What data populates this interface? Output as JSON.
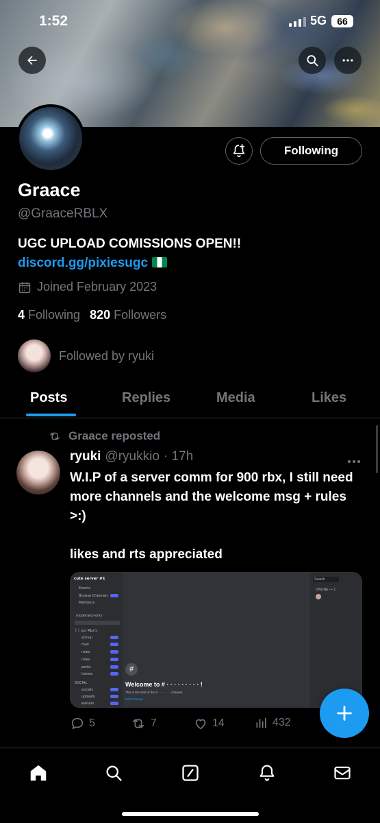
{
  "status_bar": {
    "time": "1:52",
    "network": "5G",
    "battery": "66"
  },
  "header": {
    "back_icon": "back-arrow-icon",
    "search_icon": "search-icon",
    "more_icon": "more-icon"
  },
  "profile": {
    "display_name": "Graace",
    "handle": "@GraaceRBLX",
    "bio_text": "UGC UPLOAD COMISSIONS OPEN!! ",
    "bio_link": "discord.gg/pixiesugc",
    "joined": "Joined February 2023",
    "following_count": "4",
    "following_label": "Following",
    "followers_count": "820",
    "followers_label": "Followers",
    "followed_by": "Followed by ryuki",
    "follow_button": "Following"
  },
  "tabs": [
    {
      "label": "Posts",
      "active": true
    },
    {
      "label": "Replies",
      "active": false
    },
    {
      "label": "Media",
      "active": false
    },
    {
      "label": "Likes",
      "active": false
    }
  ],
  "tweet": {
    "repost_label": "Graace reposted",
    "author_name": "ryuki",
    "author_handle": "@ryukkio",
    "time": "· 17h",
    "text": "W.I.P of a server comm for 900 rbx, I still need more channels and the welcome msg + rules >:)\n\nlikes and rts appreciated",
    "replies": "5",
    "reposts": "7",
    "likes": "14",
    "views": "432",
    "media": {
      "server_name": "cute server #1",
      "channels_top": [
        "Events",
        "Browse Channels",
        "Members"
      ],
      "category_mod": "moderator-only",
      "category_info": "꒰꒱ our Rbx's",
      "info_channels": [
        "arrival",
        "mail",
        "rules",
        "roles",
        "perks",
        "tickets"
      ],
      "category_social": "SOCIAL",
      "social_channels": [
        "socials",
        "uploads",
        "waiters"
      ],
      "welcome": "Welcome to # · · · · · · · · · !",
      "welcome_sub": "This is the start of the # · · · · · · · channel.",
      "edit_channel": "Edit Channel",
      "online_label": "ONLINE — 1",
      "search_label": "Search"
    }
  },
  "colors": {
    "accent": "#1d9bf0",
    "muted": "#71767b",
    "background": "#000000"
  }
}
